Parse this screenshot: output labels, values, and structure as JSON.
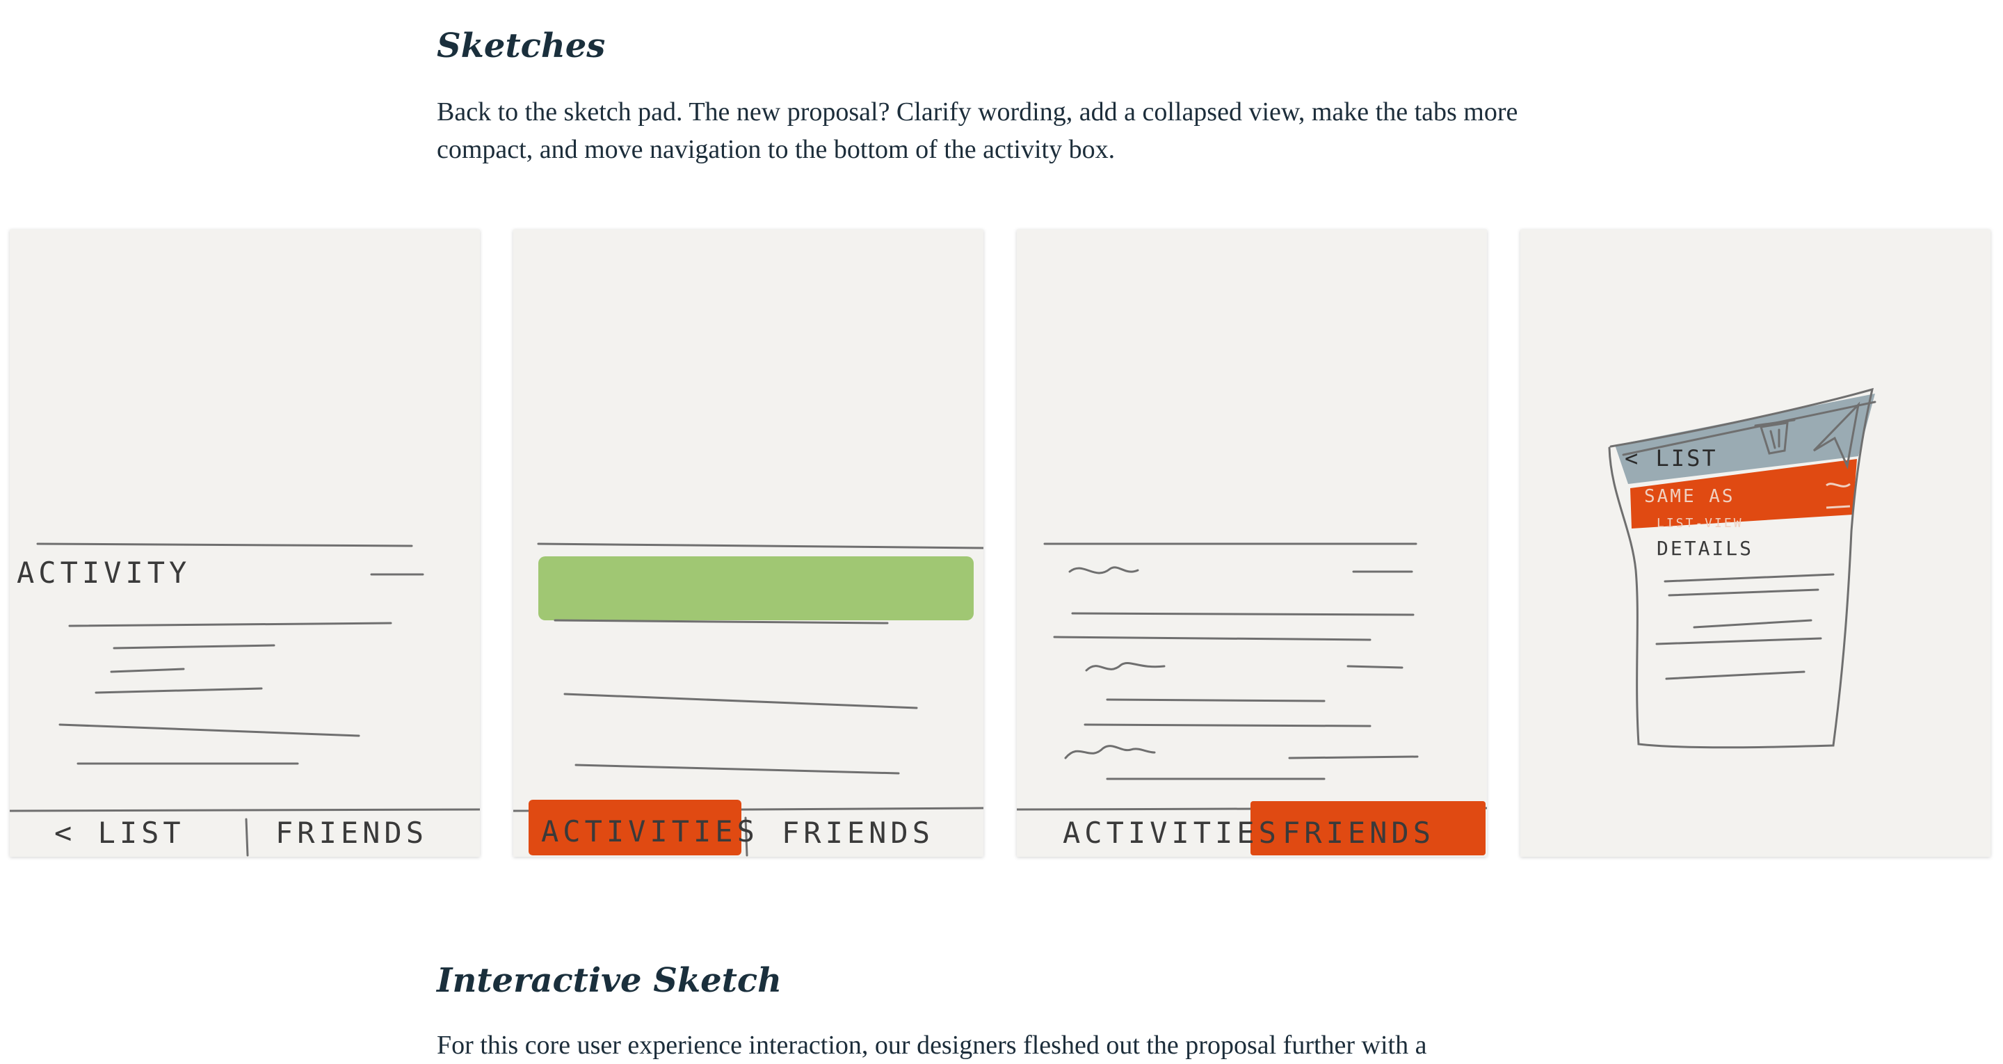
{
  "sketches_section": {
    "heading": "Sketches",
    "paragraph": "Back to the sketch pad. The new proposal? Clarify wording, add a collapsed view, make the tabs more compact, and move navigation to the bottom of the activity box."
  },
  "gallery": {
    "sketch1": {
      "activity_label": "ACTIVITY",
      "tab_left": "< LIST",
      "tab_right": "FRIENDS"
    },
    "sketch2": {
      "tab_left": "ACTIVITIES",
      "tab_right": "FRIENDS"
    },
    "sketch3": {
      "tab_left": "ACTIVITIES",
      "tab_right": "FRIENDS"
    },
    "sketch4": {
      "back_label": "< LIST",
      "banner_line1": "SAME AS",
      "banner_line2": "LIST-VIEW",
      "details_label": "DETAILS",
      "trash_icon": "trash-icon",
      "send_icon": "send-icon"
    }
  },
  "interactive_section": {
    "heading": "Interactive Sketch",
    "paragraph": "For this core user experience interaction, our designers fleshed out the proposal further with a"
  },
  "colors": {
    "orange": "#e04a12",
    "green": "#a0c773",
    "slate": "#9aabb3",
    "paper": "#f3f2ef"
  }
}
